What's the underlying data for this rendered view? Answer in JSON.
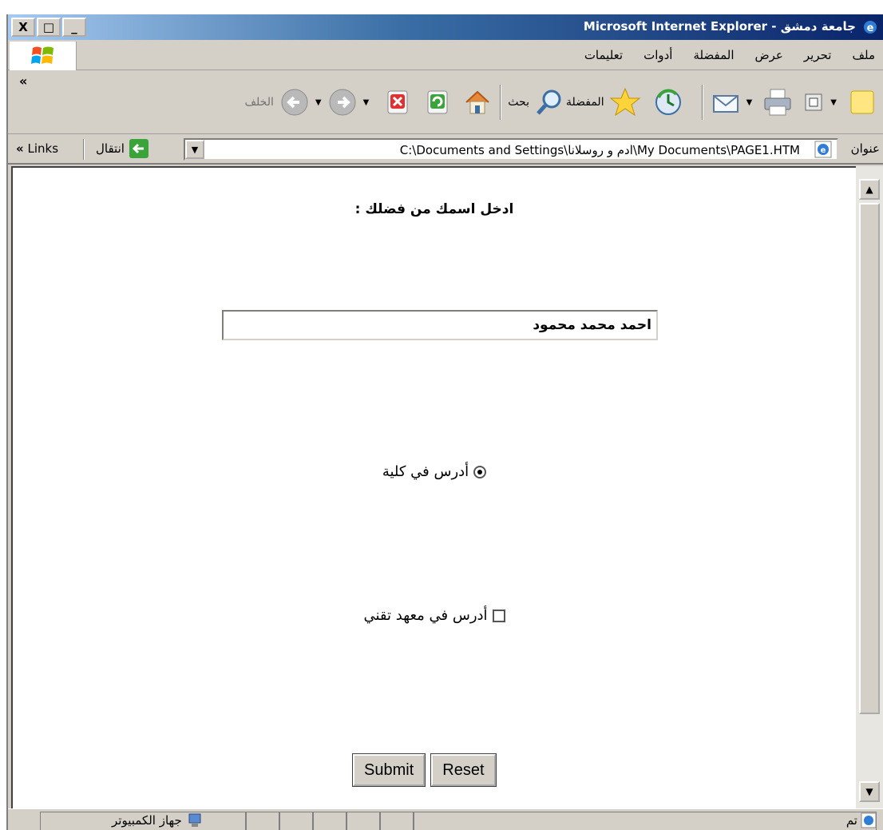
{
  "window": {
    "title": "جامعة دمشق - Microsoft Internet Explorer",
    "buttons": {
      "close": "X",
      "maximize": "□",
      "minimize": "_"
    }
  },
  "menu": {
    "items": [
      "ملف",
      "تحرير",
      "عرض",
      "المفضلة",
      "أدوات",
      "تعليمات"
    ]
  },
  "toolbar": {
    "back_label": "الخلف",
    "search_label": "بحث",
    "favorites_label": "المفضلة",
    "chevron": "«"
  },
  "address": {
    "label": "عنوان",
    "url": "C:\\Documents and Settings\\ادم و روسلانا\\My Documents\\PAGE1.HTM",
    "go_label": "انتقال",
    "links_label": "Links",
    "links_chevron": "«"
  },
  "form": {
    "prompt": "ادخل اسمك من فضلك :",
    "name_value": "احمد محمد محمود",
    "radio_label": "أدرس في كلية",
    "radio_checked": true,
    "checkbox_label": "أدرس في معهد تقني",
    "checkbox_checked": false,
    "submit_label": "Submit",
    "reset_label": "Reset"
  },
  "statusbar": {
    "status": "تم",
    "zone": "جهاز الكمبيوتر"
  }
}
